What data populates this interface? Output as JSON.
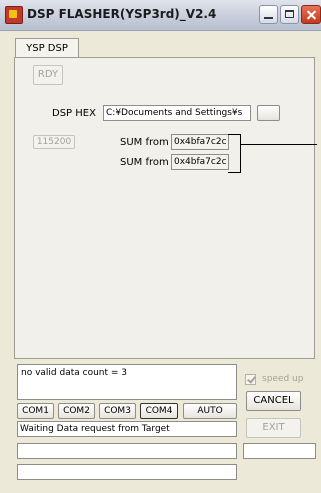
{
  "window": {
    "title": "DSP FLASHER(YSP3rd)_V2.4",
    "icon": "app-icon"
  },
  "tab": {
    "label": "YSP DSP"
  },
  "panel": {
    "rdy_button": "RDY",
    "dsp_hex_label": "DSP HEX",
    "dsp_hex_path": "C:¥Documents and Settings¥s",
    "browse_label": "",
    "baud_label": "115200",
    "sum_label_1": "SUM from",
    "sum_value_1": "0x4bfa7c2c",
    "sum_label_2": "SUM from",
    "sum_value_2": "0x4bfa7c2c"
  },
  "status": {
    "message": "no valid data count = 3",
    "waiting": "Waiting Data request from Target"
  },
  "speed_up": {
    "label": "speed up",
    "checked": true,
    "enabled": false
  },
  "buttons": {
    "com1": "COM1",
    "com2": "COM2",
    "com3": "COM3",
    "com4": "COM4",
    "auto": "AUTO",
    "cancel": "CANCEL",
    "exit": "EXIT"
  }
}
